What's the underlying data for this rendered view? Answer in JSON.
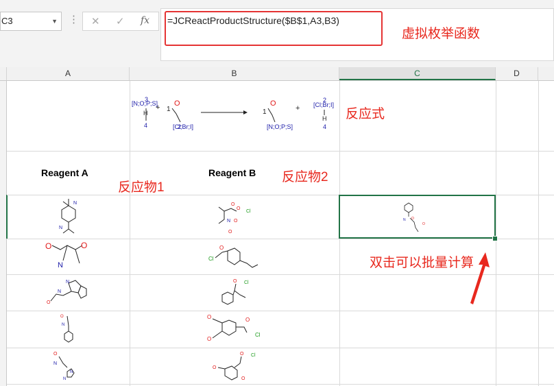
{
  "name_box": {
    "value": "C3"
  },
  "formula_bar": {
    "cancel_icon": "close-icon",
    "enter_icon": "check-icon",
    "fx_label": "fx",
    "formula": "=JCReactProductStructure($B$1,A3,B3)"
  },
  "columns": [
    "A",
    "B",
    "C",
    "D"
  ],
  "selected_cell": "C3",
  "cells": {
    "a2": "Reagent A",
    "b2": "Reagent B"
  },
  "annotations": {
    "virtual_enum": "虚拟枚举函数",
    "reaction_formula": "反应式",
    "reactant1": "反应物1",
    "reactant2": "反应物2",
    "batch_calc": "双击可以批量计算"
  },
  "reaction_template": {
    "reactant1_atoms": "[N;O;P;S]",
    "reactant1_h": "H",
    "reactant1_num_top": "3",
    "reactant1_num_bottom": "4",
    "reactant2_o": "O",
    "reactant2_num": "1",
    "reactant2_x": "[Cl;Br;I]",
    "reactant2_num2": "2",
    "product_o": "O",
    "product_num": "1",
    "product_x": "[N;O;P;S]",
    "byproduct_x": "[Cl;Br;I]",
    "byproduct_h": "H",
    "byproduct_num_top": "2",
    "byproduct_num_bottom": "4",
    "plus": "+"
  },
  "colors": {
    "accent_green": "#217346",
    "annotation_red": "#e8281e",
    "atom_n": "#1a1aa8",
    "atom_o": "#e11a1a",
    "atom_cl": "#1a9a1a"
  }
}
